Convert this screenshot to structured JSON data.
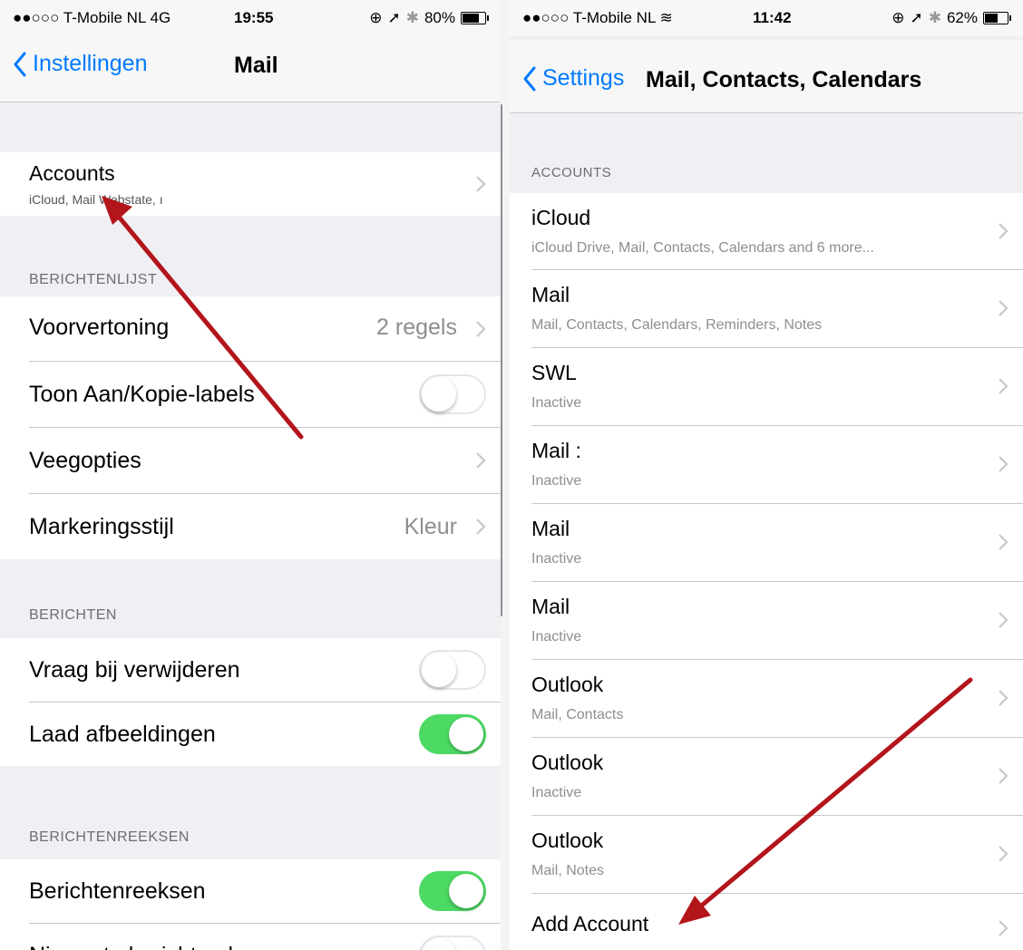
{
  "left": {
    "status": {
      "carrier": "●●○○○ T-Mobile NL  4G",
      "time": "19:55",
      "battery": "80%",
      "battery_level": 0.8
    },
    "nav": {
      "back_label": "Instellingen",
      "title": "Mail"
    },
    "accounts": {
      "label": "Accounts",
      "sub": "iCloud, Mail Webstate, ı"
    },
    "section_list": "BERICHTENLIJST",
    "list_rows": [
      {
        "label": "Voorvertoning",
        "value": "2 regels"
      },
      {
        "label": "Toon Aan/Kopie-labels",
        "toggle": false
      },
      {
        "label": "Veegopties"
      },
      {
        "label": "Markeringsstijl",
        "value": "Kleur"
      }
    ],
    "section_messages": "BERICHTEN",
    "message_rows": [
      {
        "label": "Vraag bij verwijderen",
        "toggle": false
      },
      {
        "label": "Laad afbeeldingen",
        "toggle": true
      }
    ],
    "section_threads": "BERICHTENREEKSEN",
    "thread_rows": [
      {
        "label": "Berichtenreeksen",
        "toggle": true
      },
      {
        "label": "Nieuwste berichten bovenaan",
        "toggle": false
      }
    ]
  },
  "right": {
    "status": {
      "carrier": "●●○○○ T-Mobile NL",
      "time": "11:42",
      "battery": "62%",
      "battery_level": 0.62
    },
    "nav": {
      "back_label": "Settings",
      "title": "Mail, Contacts, Calendars"
    },
    "section_accounts": "ACCOUNTS",
    "accounts": [
      {
        "label": "iCloud",
        "sub": "iCloud Drive, Mail, Contacts, Calendars and 6 more..."
      },
      {
        "label": "Mail",
        "sub": "Mail, Contacts, Calendars, Reminders, Notes"
      },
      {
        "label": "SWL",
        "sub": "Inactive"
      },
      {
        "label": "Mail :",
        "sub": "Inactive"
      },
      {
        "label": "Mail",
        "sub": "Inactive"
      },
      {
        "label": "Mail",
        "sub": "Inactive"
      },
      {
        "label": "Outlook",
        "sub": "Mail, Contacts"
      },
      {
        "label": "Outlook",
        "sub": "Inactive"
      },
      {
        "label": "Outlook",
        "sub": "Mail, Notes"
      }
    ],
    "add_account": "Add Account"
  },
  "colors": {
    "accent": "#007aff",
    "toggle_on": "#4cd964",
    "arrow": "#b3151b"
  },
  "icons": [
    "chevron-left-icon",
    "chevron-right-icon",
    "wifi-icon",
    "location-icon",
    "bluetooth-icon",
    "lock-rotation-icon",
    "battery-icon",
    "arrow-annotation"
  ]
}
